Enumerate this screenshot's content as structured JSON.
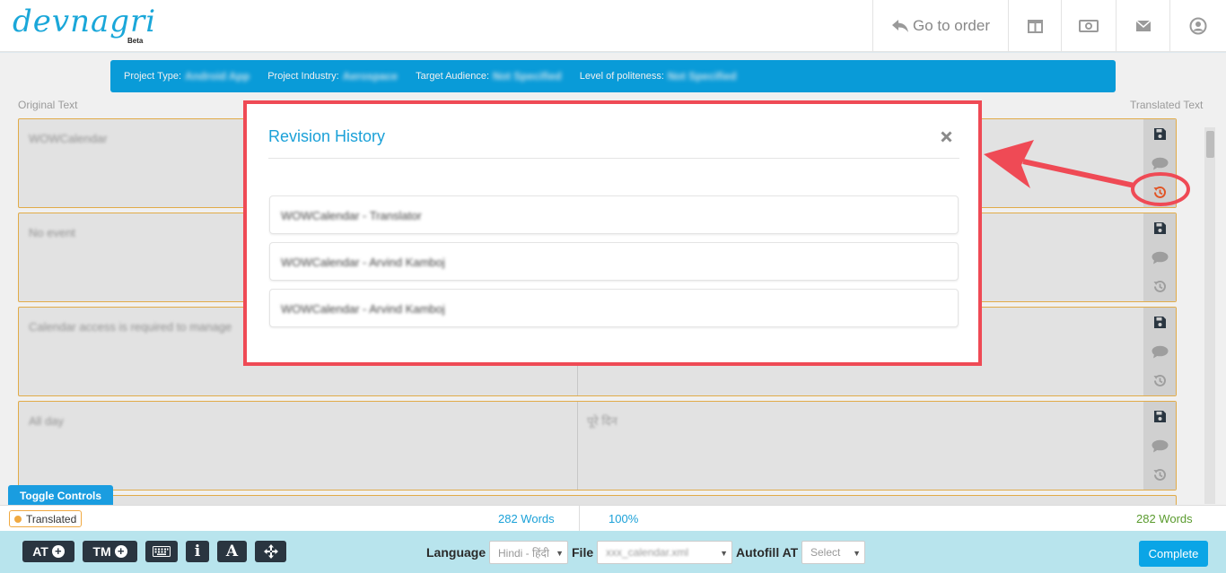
{
  "header": {
    "logo_text": "devnagri",
    "logo_badge": "Beta",
    "go_to_order_label": "Go to order"
  },
  "project_info": {
    "project_type_label": "Project Type:",
    "project_type_value": "Android App",
    "industry_label": "Project Industry:",
    "industry_value": "Aerospace",
    "audience_label": "Target Audience:",
    "audience_value": "Not Specified",
    "politeness_label": "Level of politeness:",
    "politeness_value": "Not Specified"
  },
  "columns": {
    "original_label": "Original Text",
    "translated_label": "Translated Text"
  },
  "segments": [
    {
      "source": "WOWCalendar",
      "target": ""
    },
    {
      "source": "No event",
      "target": ""
    },
    {
      "source": "Calendar access is required to manage",
      "target": ""
    },
    {
      "source": "All day",
      "target": "पूरे दिन"
    }
  ],
  "modal": {
    "title": "Revision History",
    "items": [
      "WOWCalendar - Translator",
      "WOWCalendar - Arvind Kamboj",
      "WOWCalendar - Arvind Kamboj"
    ]
  },
  "status": {
    "toggle_label": "Toggle Controls",
    "translated_label": "Translated",
    "words_left": "282 Words",
    "percent": "100%",
    "words_right": "282 Words"
  },
  "toolbar": {
    "at_label": "AT",
    "tm_label": "TM",
    "info_label": "i",
    "font_label": "A",
    "language_label": "Language",
    "language_value": "Hindi - हिंदी",
    "file_label": "File",
    "file_value": "xxx_calendar.xml",
    "autofill_label": "Autofill AT",
    "autofill_value": "Select",
    "complete_label": "Complete"
  },
  "colors": {
    "brand": "#0aa5e6",
    "segment_border": "#f0b64d",
    "annotation": "#ef4a55",
    "toolbar_bg": "#b8e4ed"
  }
}
